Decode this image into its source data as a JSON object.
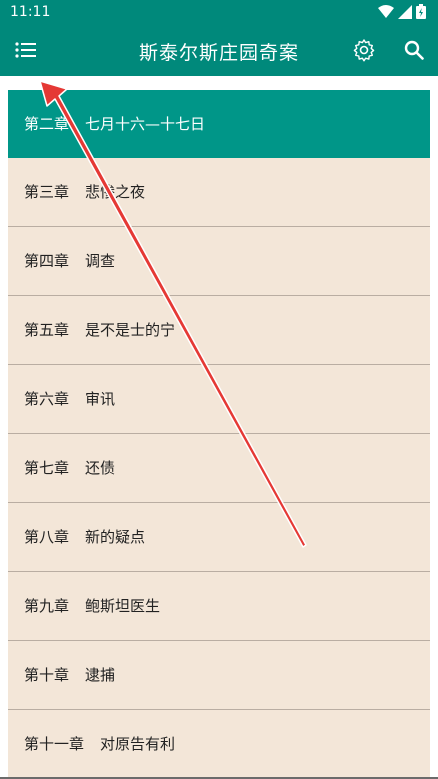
{
  "status_bar": {
    "time": "11:11"
  },
  "app_bar": {
    "title": "斯泰尔斯庄园奇案"
  },
  "icons": {
    "menu": "menu-icon",
    "settings": "gear-icon",
    "search": "search-icon",
    "wifi": "wifi-icon",
    "signal": "signal-icon",
    "battery": "battery-icon"
  },
  "colors": {
    "accent": "#00897b",
    "active_row": "#009688",
    "list_background": "#f3e6d8",
    "arrow": "#e53935"
  },
  "chapters": [
    {
      "num": "第二章",
      "title": "七月十六—十七日",
      "active": true
    },
    {
      "num": "第三章",
      "title": "悲惨之夜",
      "active": false
    },
    {
      "num": "第四章",
      "title": "调查",
      "active": false
    },
    {
      "num": "第五章",
      "title": "是不是士的宁",
      "active": false
    },
    {
      "num": "第六章",
      "title": "审讯",
      "active": false
    },
    {
      "num": "第七章",
      "title": "还债",
      "active": false
    },
    {
      "num": "第八章",
      "title": "新的疑点",
      "active": false
    },
    {
      "num": "第九章",
      "title": "鲍斯坦医生",
      "active": false
    },
    {
      "num": "第十章",
      "title": "逮捕",
      "active": false
    },
    {
      "num": "第十一章",
      "title": "对原告有利",
      "active": false
    }
  ]
}
